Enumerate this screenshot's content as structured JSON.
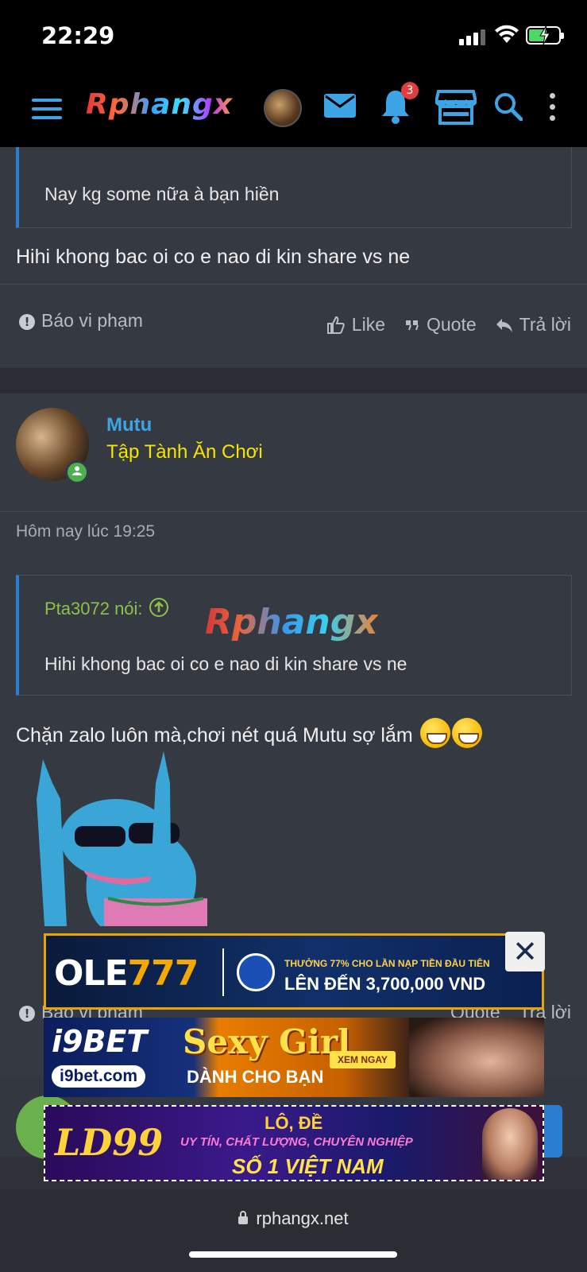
{
  "status_bar": {
    "time": "22:29"
  },
  "navbar": {
    "logo": "Rphangx",
    "notification_count": "3"
  },
  "post_prev": {
    "quote_text": "Nay kg some nữa à bạn hiền",
    "body": "Hihi khong bac oi co e nao di kin share vs ne",
    "report_label": "Báo vi phạm",
    "like_label": "Like",
    "quote_label": "Quote",
    "reply_label": "Trả lời"
  },
  "post_main": {
    "username": "Mutu",
    "user_title": "Tập Tành Ăn Chơi",
    "timestamp": "Hôm nay lúc 19:25",
    "quote_author": "Pta3072 nói:",
    "quote_text": "Hihi khong bac oi co e nao di kin share vs ne",
    "watermark": "Rphangx",
    "body": "Chặn zalo luôn mà,chơi nét quá Mutu sợ lắm",
    "report_label": "Báo vi phạm",
    "quote_label": "Quote",
    "reply_label": "Trả lời"
  },
  "ads": {
    "ole": {
      "brand_a": "OLE",
      "brand_b": "777",
      "line1": "THƯỞNG 77% CHO LẦN NẠP TIỀN ĐẦU TIÊN",
      "line2": "LÊN ĐẾN 3,700,000 VND",
      "close": "✕"
    },
    "i9bet": {
      "brand": "i9BET",
      "site": "i9bet.com",
      "headline": "Sexy Girl",
      "sub": "DÀNH CHO BẠN",
      "cta": "XEM NGAY"
    },
    "ld": {
      "brand": "LD99",
      "line1": "LÔ, ĐỀ",
      "line2": "UY TÍN, CHẤT LƯỢNG, CHUYÊN NGHIỆP",
      "line3": "SỐ 1 VIỆT NAM"
    }
  },
  "browser": {
    "url": "rphangx.net"
  }
}
